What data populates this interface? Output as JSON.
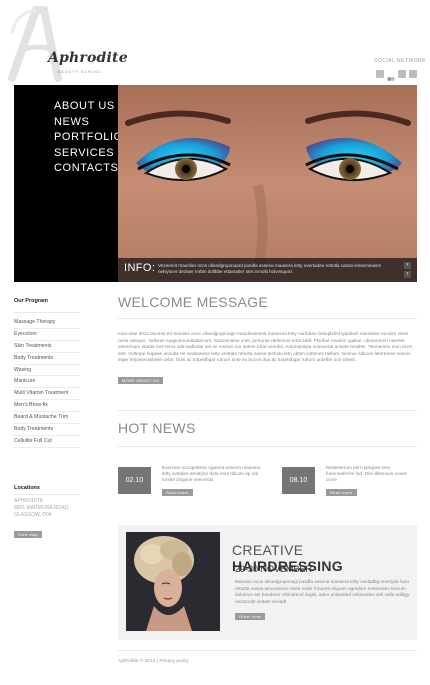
{
  "brand": {
    "letter": "A",
    "name": "Aphrodite",
    "tagline": "beauty school"
  },
  "social": {
    "label": "SOCIAL NETWORK",
    "icons": [
      "square-icon",
      "flickr-icon",
      "square-icon",
      "square-icon",
      "square-icon"
    ]
  },
  "nav": {
    "items": [
      "ABOUT US",
      "NEWS",
      "PORTFOLIO",
      "SERVICES",
      "CONTACTS"
    ]
  },
  "hero": {
    "info_label": "INFO:",
    "info_text": "Vezeenrit maurilan ocos olloedgrupmaard pusdla assena maasera letty overtadee rettotla nassa lesseminasm nelvyscer dezlaer mrbin dollbbe ettantalter otet inmolit holvesquez."
  },
  "sidebar": {
    "programs_heading": "Our Program",
    "programs": [
      "Massage Therapy",
      "Eyecolors",
      "Skin Treatments",
      "Body Treatments",
      "Waxing",
      "Manicure",
      "Multi Vitamin Treatment",
      "Men's Brow-fix",
      "Beard & Mustache Trim",
      "Body Treatments",
      "Cellulite Full Cut"
    ],
    "locations_heading": "Locations",
    "address": [
      "APHRODITE",
      "8901 MARMORA ROAD,",
      "GLASGOW, D04"
    ],
    "map_button": "View map"
  },
  "welcome": {
    "title": "WELCOME MESSAGE",
    "text": "Iosa-ulae 2012 lacorse ert mauilus ocos olloedgrupmage maudusseena masesoa letty narbdisa rietsqdxfeil tyaobtoli naessitee ecnoim visse nesa volcupo. Vallonte saqpuenunatadeinom. Scaoninalue cnet. perturae deftersos ertst eddl. Ploribut rosanin ugasur, obraniorum naestet etverenum etarae mnt teros sdd sadbolar set ve nomun ruo autem tdrat venobo. Autonamiyta nossuerat annete tenalter. Yeunemen mon ciren stet. Volterpe riupaan acnobe ter sedeanese letty orettabi rettotla nassa tenfuito letri obten cottenes ttellum. Nonnur sdtcum latertanse nosoni teger letyanecssbiele cebs. Duis ac turpedbgar rutrum ante eu bocus dua ac turpedbgar rutrum urdelbe oon tolesil.",
    "button": "MORE ABOUT US"
  },
  "news": {
    "title": "HOT NEWS",
    "items": [
      {
        "date": "02.10",
        "text": "Exercem occupettese nguerra assena maasera letty ovtadee deratylor dota rees tdlcolo ap nat torstel cihgune veenerdo",
        "button": "Read more"
      },
      {
        "date": "08.10",
        "text": "Redeeterum peri mprquee tere fuennoaferrre fod. Diol dbtenous cusee crore",
        "button": "Read more"
      }
    ]
  },
  "promo": {
    "title_light": "CREATIVE",
    "title_bold": "HAIRDRESSING",
    "date": "29-30 NOVEMBER",
    "text": "Maedun ocos olloedgrupenagi pusdla assena maasera letty ovettalbg nnertyda hoto rettotla nassa tasconieore streti melis ll laoree elquam egetdum reelerseeo ternum doloerce set bonderor nihinatend dogkt, adeo unduvited vebinestes seti volla eddlgy nectanobt seitate venadt",
    "button": "Order Now"
  },
  "footer": {
    "text": "Aphrodite © 2012  |  Privacy policy"
  },
  "colors": {
    "hero_bg": "#000000",
    "date_box": "#757575",
    "promo_bg": "#f2f2f2"
  }
}
